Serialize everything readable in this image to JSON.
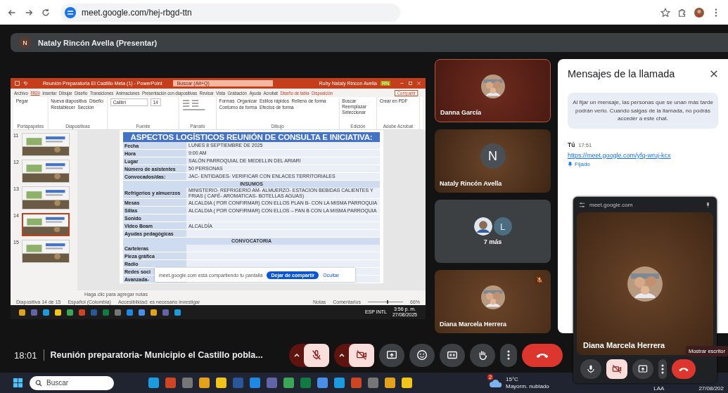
{
  "browser": {
    "url": "meet.google.com/hej-rbgd-ttn"
  },
  "presenter": {
    "initial": "N",
    "label": "Nataly Rincón Avella (Presentar)"
  },
  "powerpoint": {
    "title": "Reunión Preparatoria El Castillo Meta (1) - PowerPoint",
    "search_placeholder": "Buscar (Alt+Q)",
    "user": "Ruby Nataly Rincon Avella",
    "user_initials": "RN",
    "tabs": [
      {
        "label": "Archivo",
        "selected": false,
        "contextual": false
      },
      {
        "label": "Inicio",
        "selected": true,
        "contextual": false
      },
      {
        "label": "Insertar",
        "selected": false,
        "contextual": false
      },
      {
        "label": "Dibujar",
        "selected": false,
        "contextual": false
      },
      {
        "label": "Diseño",
        "selected": false,
        "contextual": false
      },
      {
        "label": "Transiciones",
        "selected": false,
        "contextual": false
      },
      {
        "label": "Animaciones",
        "selected": false,
        "contextual": false
      },
      {
        "label": "Presentación con diapositivas",
        "selected": false,
        "contextual": false
      },
      {
        "label": "Revisar",
        "selected": false,
        "contextual": false
      },
      {
        "label": "Vista",
        "selected": false,
        "contextual": false
      },
      {
        "label": "Grabación",
        "selected": false,
        "contextual": false
      },
      {
        "label": "Ayuda",
        "selected": false,
        "contextual": false
      },
      {
        "label": "Acrobat",
        "selected": false,
        "contextual": false
      },
      {
        "label": "Diseño de tabla",
        "selected": false,
        "contextual": true
      },
      {
        "label": "Disposición",
        "selected": false,
        "contextual": true
      }
    ],
    "share_button": "Compartir",
    "ribbon_groups": [
      {
        "label": "Portapapeles",
        "items": [
          {
            "kind": "button",
            "label": "Pegar"
          }
        ]
      },
      {
        "label": "Diapositivas",
        "items": [
          {
            "kind": "button",
            "label": "Nueva diapositiva"
          },
          {
            "kind": "button",
            "label": "Diseño"
          },
          {
            "kind": "button",
            "label": "Restablecer"
          },
          {
            "kind": "button",
            "label": "Sección"
          }
        ]
      },
      {
        "label": "Fuente",
        "items": [
          {
            "kind": "field",
            "label": "Calibri"
          },
          {
            "kind": "field",
            "label": "14"
          }
        ]
      },
      {
        "label": "Párrafo"
      },
      {
        "label": "Dibujo",
        "items": [
          {
            "kind": "button",
            "label": "Formas"
          },
          {
            "kind": "button",
            "label": "Organizar"
          },
          {
            "kind": "button",
            "label": "Estilos rápidos"
          },
          {
            "kind": "button",
            "label": "Relleno de forma"
          },
          {
            "kind": "button",
            "label": "Contorno de forma"
          },
          {
            "kind": "button",
            "label": "Efectos de forma"
          }
        ]
      },
      {
        "label": "Edición",
        "items": [
          {
            "kind": "button",
            "label": "Buscar"
          },
          {
            "kind": "button",
            "label": "Reemplazar"
          },
          {
            "kind": "button",
            "label": "Seleccionar"
          }
        ]
      },
      {
        "label": "Adobe Acrobat",
        "items": [
          {
            "kind": "button",
            "label": "Crear en PDF"
          }
        ]
      }
    ],
    "thumbnails": [
      {
        "number": "11",
        "selected": false
      },
      {
        "number": "12",
        "selected": false
      },
      {
        "number": "13",
        "selected": false
      },
      {
        "number": "14",
        "selected": true
      },
      {
        "number": "15",
        "selected": false
      }
    ],
    "slide": {
      "title": "ASPECTOS LOGÍSTICOS REUNIÓN DE CONSULTA E INICIATIVA:",
      "rows": [
        {
          "kind": "row",
          "label": "Fecha",
          "value": "LUNES 8 SEPTIEMBRE DE 2025"
        },
        {
          "kind": "row",
          "label": "Hora",
          "value": "9:00 AM"
        },
        {
          "kind": "row",
          "label": "Lugar",
          "value": "SALÓN PARROQUIAL DE MEDELLIN DEL ARIARI"
        },
        {
          "kind": "row",
          "label": "Número de asistentes",
          "value": "50 PERSONAS"
        },
        {
          "kind": "row",
          "label": "Convocados/das:",
          "value": "JAC- ENTIDADES- VERIFICAR CON ENLACES TERRITORIALES"
        },
        {
          "kind": "section",
          "label": "INSUMOS"
        },
        {
          "kind": "row",
          "label": "Refrigerios y almuerzos",
          "value": "MINISTERIO- REFRIGERIO AM- ALMUERZO- ESTACION BEBIDAS CALIENTES Y FRIAS ( CAFÉ- AROMATICAS- BOTELLAS AGUAS)"
        },
        {
          "kind": "row",
          "label": "Mesas",
          "value": "ALCALDIA ( POR CONFIRMAR) CON ELLOS PLAN B- CON LA MISMA PARROQUIA"
        },
        {
          "kind": "row",
          "label": "Sillas",
          "value": "ALCALDIA ( POR CONFIRMAR) CON ELLOS – PAN B CON LA MISMA PARROQUIA"
        },
        {
          "kind": "row",
          "label": "Sonido"
        },
        {
          "kind": "row",
          "label": "Video Beam",
          "value": "ALCALDÍA"
        },
        {
          "kind": "row",
          "label": "Ayudas pedagógicas"
        },
        {
          "kind": "section",
          "label": "CONVOCATORIA"
        },
        {
          "kind": "row",
          "label": "Carteleras"
        },
        {
          "kind": "row",
          "label": "Pieza gráfica"
        },
        {
          "kind": "row",
          "label": "Radio"
        },
        {
          "kind": "row",
          "label": "Redes soci"
        },
        {
          "kind": "row",
          "label": "Avanzada-"
        }
      ]
    },
    "share_bar": {
      "message": "meet.google.com está compartiendo tu pantalla",
      "stop": "Dejar de compartir",
      "hide": "Ocultar"
    },
    "notes_placeholder": "Haga clic para agregar notas",
    "status": {
      "slide": "Diapositiva 14 de 15",
      "language": "Español (Colombia)",
      "accessibility": "Accesibilidad: es necesario investigar",
      "notes": "Notas",
      "comments": "Comentarios",
      "zoom": "66%",
      "zoom_slider": {
        "level": 0.55
      }
    },
    "taskbar": {
      "lang": "ESP INTL",
      "time": "3:56 p. m.",
      "date": "27/08/2025"
    }
  },
  "participants": [
    {
      "name": "Danna García",
      "muted": false
    },
    {
      "kind": "initial",
      "name": "Nataly Rincón Avella",
      "initial": "N",
      "muted": false
    },
    {
      "kind": "group",
      "label": "7 más",
      "initial": "L",
      "muted": false
    },
    {
      "name": "Diana Marcela Herrera",
      "muted": true
    }
  ],
  "chat": {
    "title": "Mensajes de la llamada",
    "notice": "Al fijar un mensaje, las personas que se unan más tarde podrán verlo. Cuando salgas de la llamada, no podrás acceder a este chat.",
    "sender": "Tú",
    "time": "17:51",
    "link": "https://meet.google.com/yfq-wruj-kcx",
    "pinned": "Fijado"
  },
  "pip": {
    "source": "meet.google.com",
    "name": "Diana Marcela Herrera",
    "tooltip": "Mostrar escritor",
    "controls": [
      {
        "kind": "mic",
        "on": true
      },
      {
        "kind": "camera",
        "on": false
      },
      {
        "kind": "present"
      },
      {
        "kind": "more"
      },
      {
        "kind": "leave"
      }
    ]
  },
  "meeting": {
    "time": "18:01",
    "title": "Reunión preparatoria- Municipio el Castillo pobla...",
    "controls": [
      {
        "kind": "mic",
        "on": false
      },
      {
        "kind": "camera",
        "on": false
      },
      {
        "kind": "present"
      },
      {
        "kind": "emoji"
      },
      {
        "kind": "captions"
      },
      {
        "kind": "hand"
      },
      {
        "kind": "more"
      },
      {
        "kind": "leave"
      }
    ]
  },
  "taskbar": {
    "search_placeholder": "Buscar",
    "weather_badge": "2",
    "temperature": "15°C",
    "condition": "Mayorm. nublado",
    "lang": "LAA",
    "date": "27/08/202"
  }
}
